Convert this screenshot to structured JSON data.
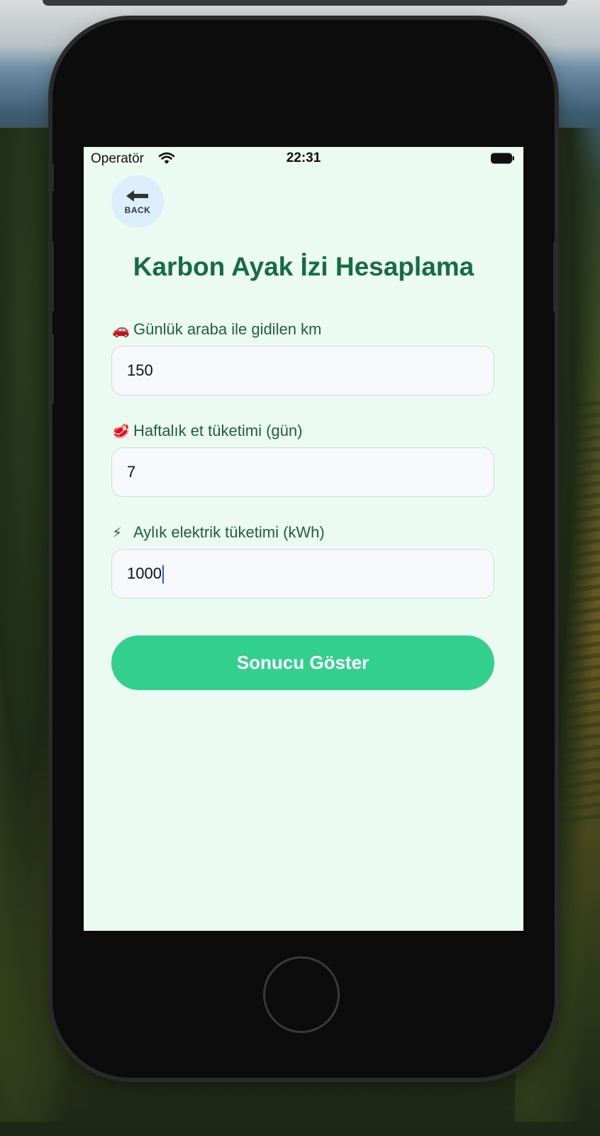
{
  "status_bar": {
    "carrier": "Operatör",
    "time": "22:31",
    "wifi_icon": "wifi-icon",
    "battery_icon": "battery-icon"
  },
  "back_button": {
    "label": "BACK",
    "icon": "back-arrow-icon"
  },
  "page": {
    "title": "Karbon Ayak İzi Hesaplama"
  },
  "form": {
    "fields": [
      {
        "emoji": "🚗",
        "label": "Günlük araba ile gidilen km",
        "value": "150"
      },
      {
        "emoji": "🥩",
        "label": "Haftalık et tüketimi (gün)",
        "value": "7"
      },
      {
        "emoji": "⚡",
        "label": "Aylık elektrik tüketimi (kWh)",
        "value": "1000"
      }
    ],
    "submit_label": "Sonucu Göster"
  },
  "colors": {
    "screen_bg": "#ecfbf1",
    "title": "#186b48",
    "button": "#33cf8e",
    "back_bg": "#dbeefb"
  }
}
